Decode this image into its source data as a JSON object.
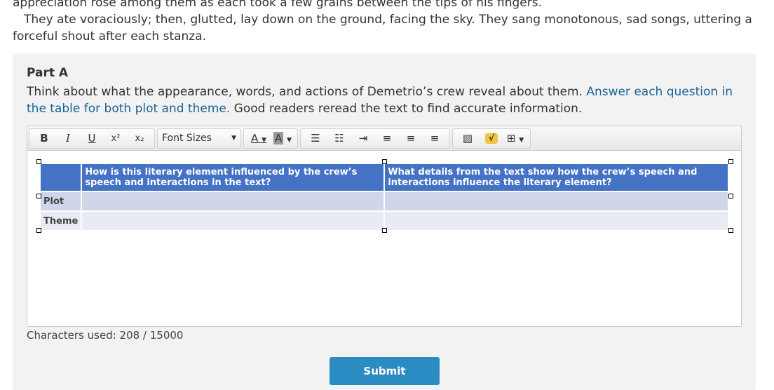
{
  "passage": {
    "p1": "appreciation rose among them as each took a few grains between the tips of his fingers.",
    "p2": "They ate voraciously; then, glutted, lay down on the ground, facing the sky. They sang monotonous, sad songs, uttering a forceful shout after each stanza."
  },
  "part": {
    "title": "Part A",
    "instr_a": "Think about what the appearance, words, and actions of Demetrio’s crew reveal about them. ",
    "instr_link": "Answer each question in the table for both plot and theme.",
    "instr_b": " Good readers reread the text to find accurate information."
  },
  "toolbar": {
    "bold": "B",
    "italic": "I",
    "underline": "U",
    "superscript": "x²",
    "subscript": "x₂",
    "font_sizes": "Font Sizes",
    "font_color": "A",
    "bg_color": "A"
  },
  "table": {
    "headers": [
      "",
      "How is this literary element influenced by the crew’s speech and interactions in the text?",
      "What details from the text show how the crew’s speech and interactions influence the literary element?"
    ],
    "rows": [
      {
        "label": "Plot"
      },
      {
        "label": "Theme"
      }
    ]
  },
  "chars_used": "Characters used: 208 / 15000",
  "submit": "Submit"
}
